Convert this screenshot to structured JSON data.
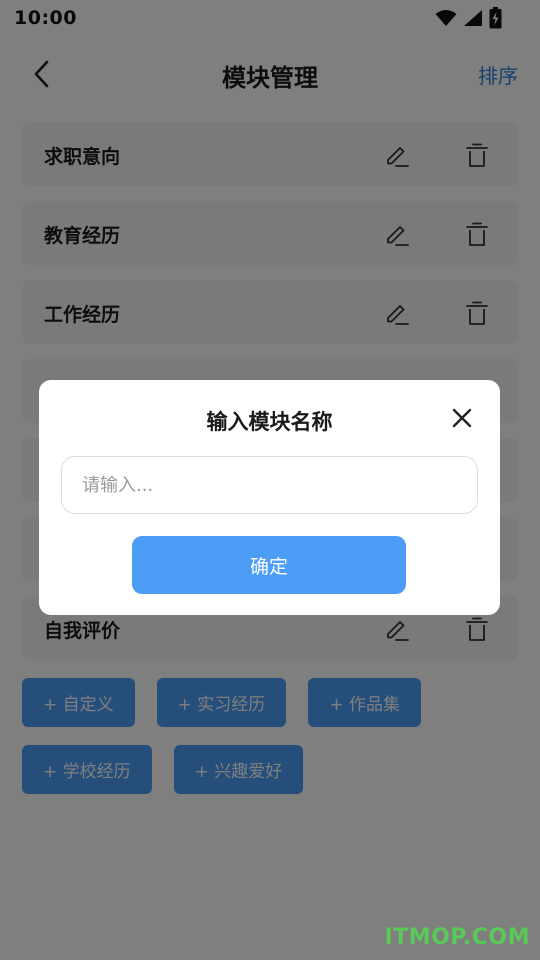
{
  "status_bar": {
    "time": "10:00"
  },
  "header": {
    "title": "模块管理",
    "sort_label": "排序"
  },
  "modules": [
    {
      "name": "求职意向"
    },
    {
      "name": "教育经历"
    },
    {
      "name": "工作经历"
    },
    {
      "name": ""
    },
    {
      "name": ""
    },
    {
      "name": ""
    },
    {
      "name": "自我评价"
    }
  ],
  "chips": [
    [
      "+ 自定义",
      "+ 实习经历",
      "+ 作品集"
    ],
    [
      "+ 学校经历",
      "+ 兴趣爱好"
    ]
  ],
  "dialog": {
    "title": "输入模块名称",
    "input_value": "",
    "input_placeholder": "请输入...",
    "confirm_label": "确定"
  },
  "watermark": "ITMOP.COM",
  "colors": {
    "accent": "#4b9df6",
    "link": "#2f7fdc",
    "row_bg": "#f3f5f8",
    "watermark": "#59c957"
  }
}
